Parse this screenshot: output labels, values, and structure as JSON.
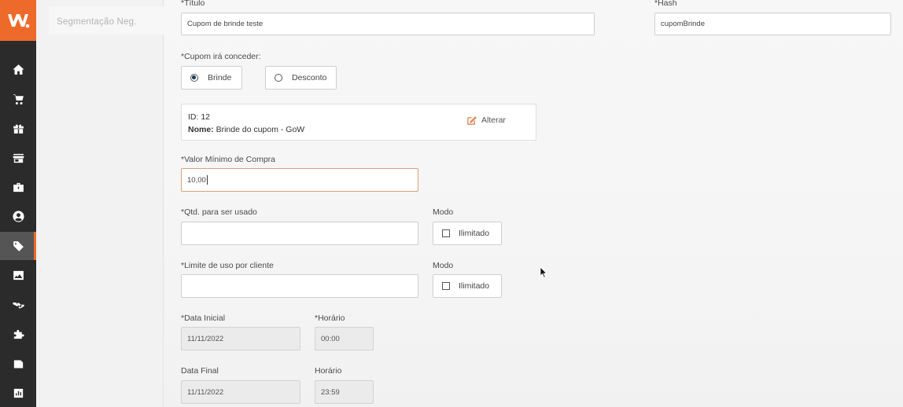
{
  "brand": {
    "logo_text": "W.",
    "accent": "#ee6a2a"
  },
  "sidebar": {
    "icons": [
      "home-icon",
      "cart-icon",
      "gift-icon",
      "store-icon",
      "briefcase-icon",
      "user-icon",
      "tag-icon",
      "image-icon",
      "handshake-icon",
      "puzzle-icon",
      "pages-icon",
      "chart-icon"
    ],
    "active": "tag-icon"
  },
  "submenu": {
    "item": "Segmentação Neg."
  },
  "form": {
    "title_label": "*Título",
    "title_value": "Cupom de brinde teste",
    "hash_label": "*Hash",
    "hash_value": "cupomBrinde",
    "grant_label": "*Cupom irá conceder:",
    "option_gift": "Brinde",
    "option_discount": "Desconto",
    "selected_option": "Brinde",
    "gift_id": "ID: 12",
    "gift_name_prefix": "Nome:",
    "gift_name": "Brinde do cupom - GoW",
    "alter_label": "Alterar",
    "min_value_label": "*Valor Mínimo de Compra",
    "min_value": "10,00",
    "qty_label": "*Qtd. para ser usado",
    "qty_value": "",
    "mode_label_1": "Modo",
    "unlimited_label_1": "Ilimitado",
    "limit_label": "*Limite de uso por cliente",
    "limit_value": "",
    "mode_label_2": "Modo",
    "unlimited_label_2": "Ilimitado",
    "start_date_label": "*Data Inicial",
    "start_date_value": "11/11/2022",
    "start_time_label": "*Horário",
    "start_time_value": "00:00",
    "end_date_label": "Data Final",
    "end_date_value": "11/11/2022",
    "end_time_label": "Horário",
    "end_time_value": "23:59"
  }
}
